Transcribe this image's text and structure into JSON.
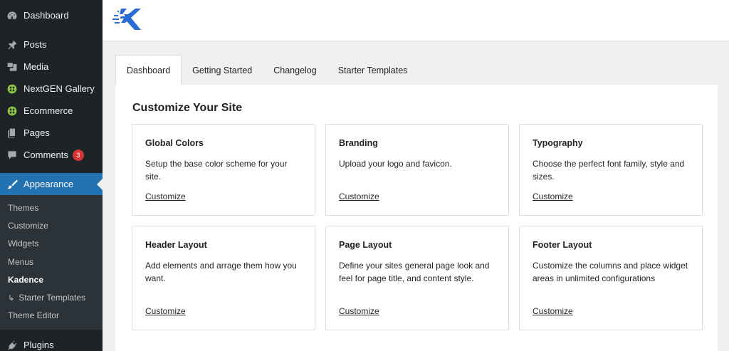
{
  "sidebar": {
    "items": [
      {
        "label": "Dashboard",
        "icon": "dashboard-icon"
      },
      {
        "label": "Posts",
        "icon": "pin-icon"
      },
      {
        "label": "Media",
        "icon": "media-icon"
      },
      {
        "label": "NextGEN Gallery",
        "icon": "gallery-icon"
      },
      {
        "label": "Ecommerce",
        "icon": "ecommerce-icon"
      },
      {
        "label": "Pages",
        "icon": "pages-icon"
      },
      {
        "label": "Comments",
        "icon": "comments-icon",
        "badge": "3"
      },
      {
        "label": "Appearance",
        "icon": "brush-icon"
      }
    ],
    "submenu": [
      {
        "label": "Themes"
      },
      {
        "label": "Customize"
      },
      {
        "label": "Widgets"
      },
      {
        "label": "Menus"
      },
      {
        "label": "Kadence"
      },
      {
        "label": "Starter Templates",
        "arrow": "↳"
      },
      {
        "label": "Theme Editor"
      }
    ],
    "plugins": {
      "label": "Plugins",
      "icon": "plugin-icon"
    }
  },
  "tabs": [
    {
      "label": "Dashboard"
    },
    {
      "label": "Getting Started"
    },
    {
      "label": "Changelog"
    },
    {
      "label": "Starter Templates"
    }
  ],
  "panel": {
    "title": "Customize Your Site",
    "cards": [
      {
        "title": "Global Colors",
        "description": "Setup the base color scheme for your site.",
        "link": "Customize"
      },
      {
        "title": "Branding",
        "description": "Upload your logo and favicon.",
        "link": "Customize"
      },
      {
        "title": "Typography",
        "description": "Choose the perfect font family, style and sizes.",
        "link": "Customize"
      },
      {
        "title": "Header Layout",
        "description": "Add elements and arrage them how you want.",
        "link": "Customize"
      },
      {
        "title": "Page Layout",
        "description": "Define your sites general page look and feel for page title, and content style.",
        "link": "Customize"
      },
      {
        "title": "Footer Layout",
        "description": "Customize the columns and place widget areas in unlimited configurations",
        "link": "Customize"
      }
    ]
  },
  "colors": {
    "sidebar_bg": "#1d2327",
    "submenu_bg": "#2c3338",
    "accent": "#2271b1",
    "badge": "#d63638",
    "logo": "#2b6cd4"
  }
}
